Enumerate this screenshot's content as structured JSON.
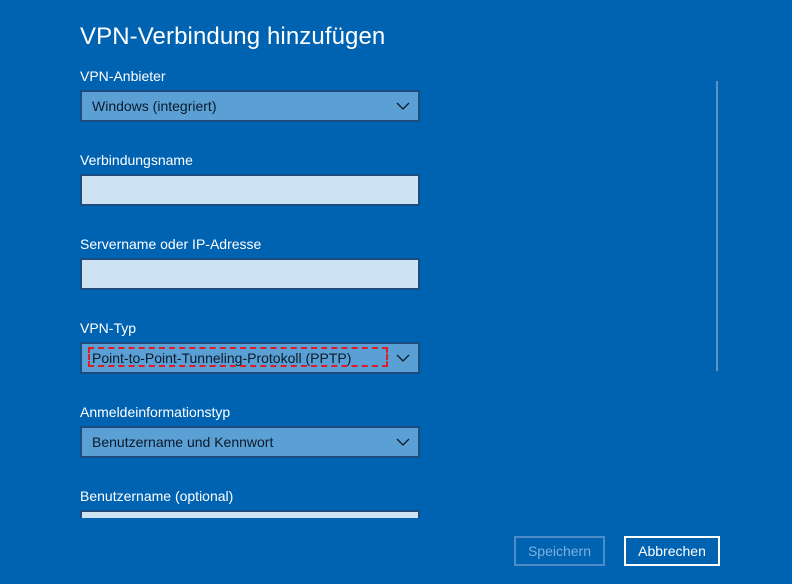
{
  "dialog": {
    "title": "VPN-Verbindung hinzufügen"
  },
  "fields": {
    "vpn_provider": {
      "label": "VPN-Anbieter",
      "value": "Windows (integriert)"
    },
    "connection_name": {
      "label": "Verbindungsname",
      "value": ""
    },
    "server_name": {
      "label": "Servername oder IP-Adresse",
      "value": ""
    },
    "vpn_type": {
      "label": "VPN-Typ",
      "value": "Point-to-Point-Tunneling-Protokoll (PPTP)"
    },
    "sign_in_type": {
      "label": "Anmeldeinformationstyp",
      "value": "Benutzername und Kennwort"
    },
    "username": {
      "label": "Benutzername (optional)",
      "value": ""
    }
  },
  "buttons": {
    "save_label": "Speichern",
    "cancel_label": "Abbrechen"
  },
  "icons": {
    "select_chevron": "chevron-down-icon"
  },
  "colors": {
    "background": "#0063b1",
    "select_fill": "#5aa0d5",
    "input_fill": "#cde3f4",
    "highlight": "#e01b24",
    "disabled_text": "#7fb0dc"
  }
}
